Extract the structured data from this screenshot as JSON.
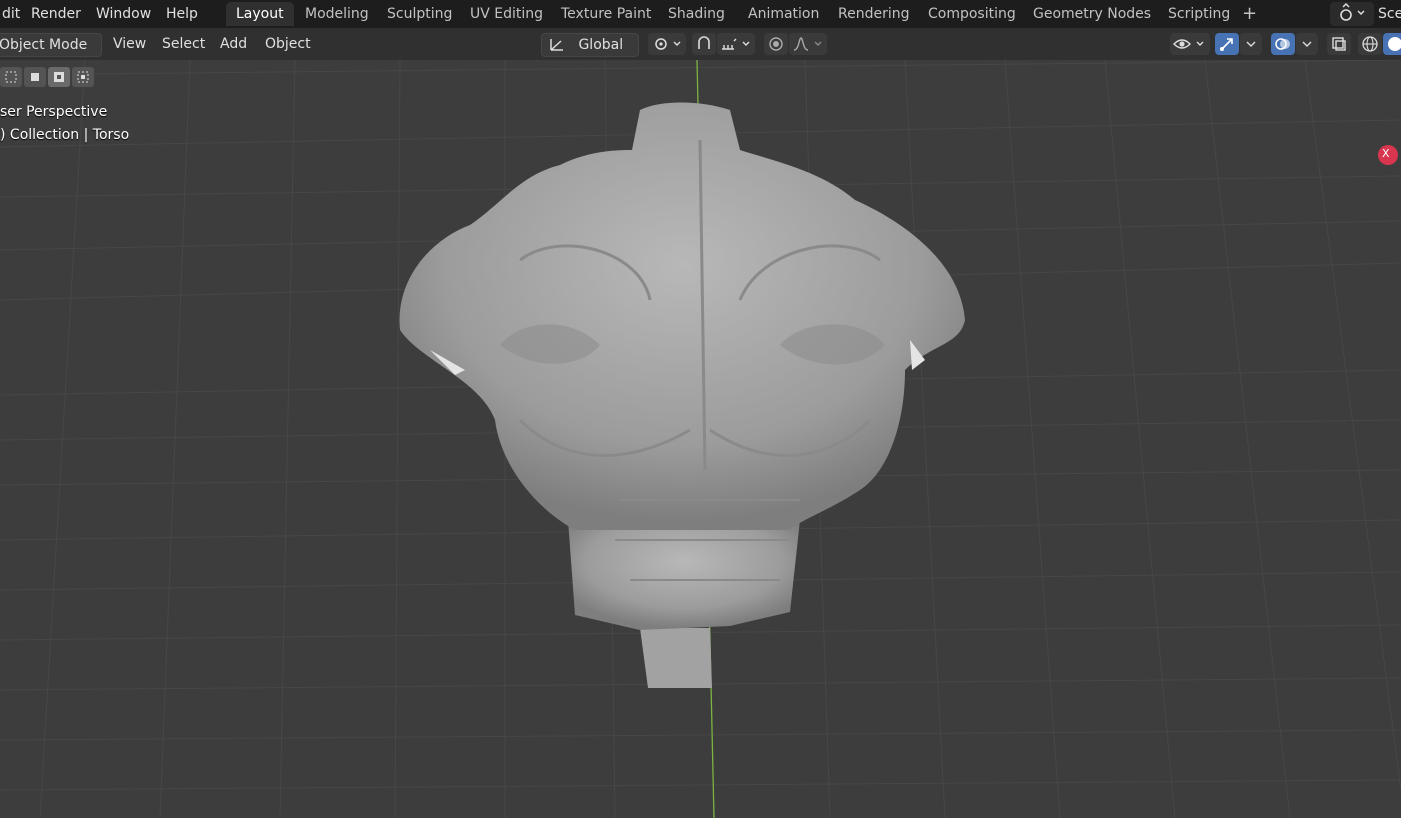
{
  "menus": [
    "dit",
    "Render",
    "Window",
    "Help"
  ],
  "workspace_tabs": [
    {
      "label": "Layout",
      "active": true
    },
    {
      "label": "Modeling"
    },
    {
      "label": "Sculpting"
    },
    {
      "label": "UV Editing"
    },
    {
      "label": "Texture Paint"
    },
    {
      "label": "Shading"
    },
    {
      "label": "Animation"
    },
    {
      "label": "Rendering"
    },
    {
      "label": "Compositing"
    },
    {
      "label": "Geometry Nodes"
    },
    {
      "label": "Scripting"
    }
  ],
  "add_tab_symbol": "+",
  "scene_label": "Sce",
  "header": {
    "mode": "Object Mode",
    "view": "View",
    "select": "Select",
    "add": "Add",
    "object": "Object",
    "transform_orientation": "Global"
  },
  "viewport": {
    "perspective_label": "ser Perspective",
    "collection_label": ") Collection | Torso",
    "gizmo_x_label": "X"
  },
  "colors": {
    "accent": "#4772b3",
    "x_axis": "#d8364f",
    "y_axis": "#8bc34a"
  }
}
